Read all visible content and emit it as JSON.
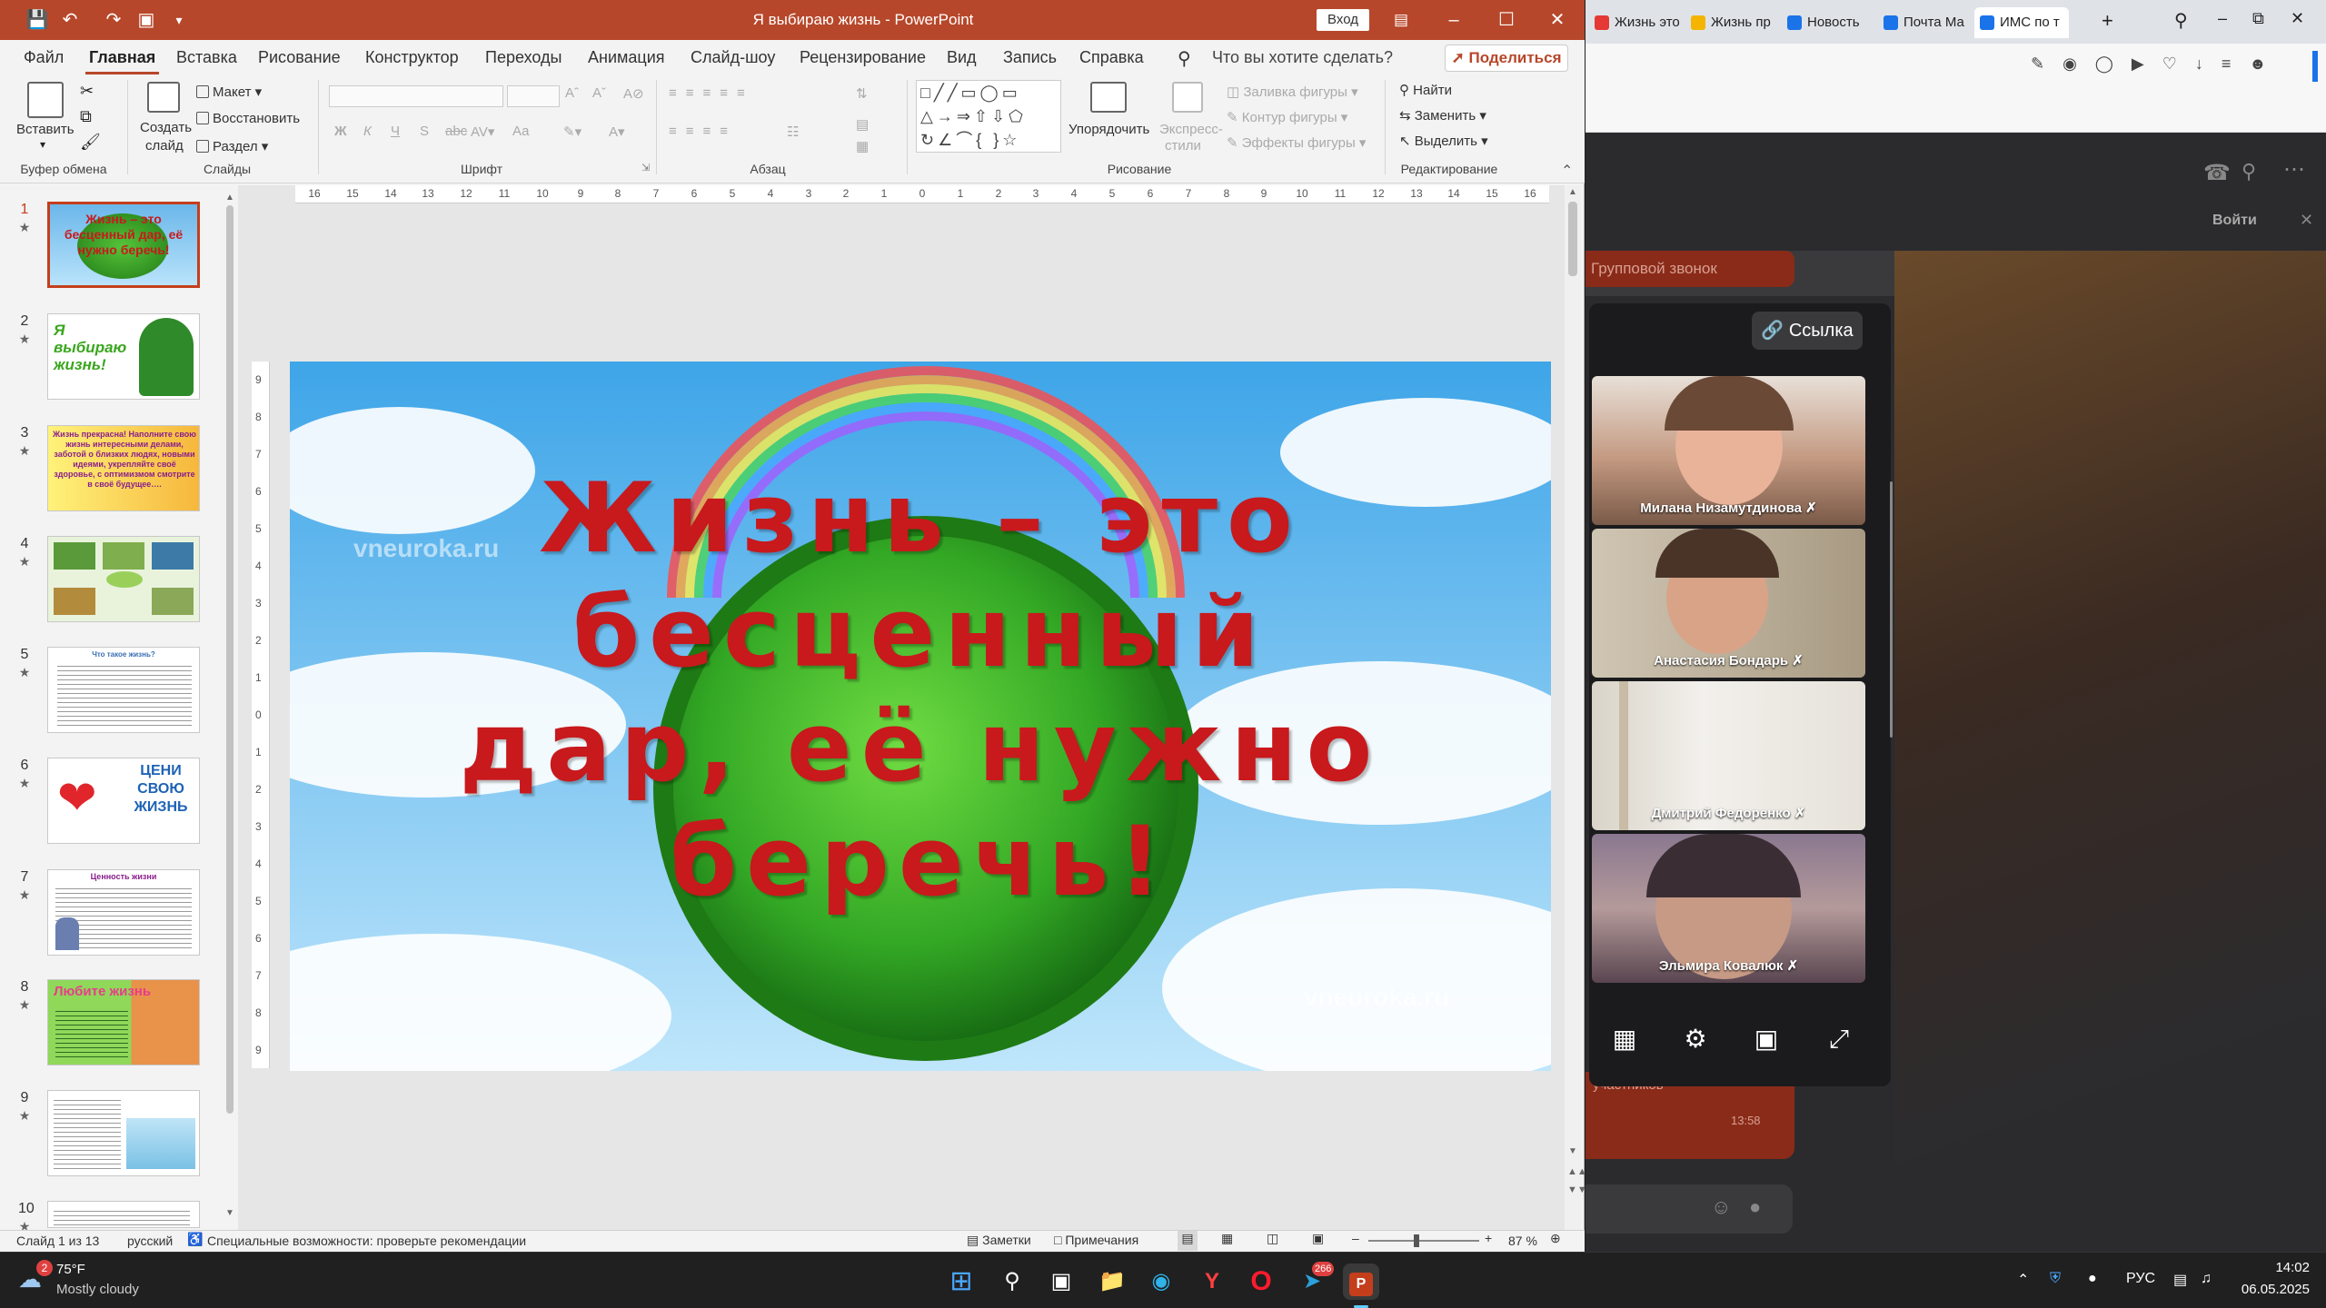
{
  "ppt": {
    "window_title": "Я выбираю жизнь - PowerPoint",
    "sign_in": "Вход",
    "menu": [
      "Файл",
      "Главная",
      "Вставка",
      "Рисование",
      "Конструктор",
      "Переходы",
      "Анимация",
      "Слайд-шоу",
      "Рецензирование",
      "Вид",
      "Запись",
      "Справка"
    ],
    "tell_me": "Что вы хотите сделать?",
    "share": "Поделиться",
    "ribbon": {
      "paste": "Вставить",
      "new_slide_1": "Создать",
      "new_slide_2": "слайд",
      "layout": "Макет",
      "reset": "Восстановить",
      "section": "Раздел",
      "arrange": "Упорядочить",
      "quick_styles_1": "Экспресс-",
      "quick_styles_2": "стили",
      "shape_fill": "Заливка фигуры",
      "shape_outline": "Контур фигуры",
      "shape_effects": "Эффекты фигуры",
      "find": "Найти",
      "replace": "Заменить",
      "select": "Выделить",
      "groups": {
        "clipboard": "Буфер обмена",
        "slides": "Слайды",
        "font": "Шрифт",
        "paragraph": "Абзац",
        "drawing": "Рисование",
        "editing": "Редактирование"
      },
      "font_btns": {
        "bold": "Ж",
        "italic": "К",
        "underline": "Ч",
        "strike": "S",
        "aa": "Аа"
      }
    },
    "ruler_h_labels": [
      "16",
      "15",
      "14",
      "13",
      "12",
      "11",
      "10",
      "9",
      "8",
      "7",
      "6",
      "5",
      "4",
      "3",
      "2",
      "1",
      "0",
      "1",
      "2",
      "3",
      "4",
      "5",
      "6",
      "7",
      "8",
      "9",
      "10",
      "11",
      "12",
      "13",
      "14",
      "15",
      "16"
    ],
    "ruler_v_labels": [
      "9",
      "8",
      "7",
      "6",
      "5",
      "4",
      "3",
      "2",
      "1",
      "0",
      "1",
      "2",
      "3",
      "4",
      "5",
      "6",
      "7",
      "8",
      "9"
    ],
    "slides": [
      {
        "num": "1",
        "text": "Жизнь – это бесценный дар, её нужно беречь!"
      },
      {
        "num": "2",
        "text": "Я выбираю жизнь!"
      },
      {
        "num": "3",
        "text": "Жизнь прекрасна! Наполните свою жизнь интересными делами, заботой о близких людях, новыми идеями, укрепляйте своё здоровье, с оптимизмом смотрите в своё будущее…."
      },
      {
        "num": "4",
        "text": ""
      },
      {
        "num": "5",
        "text": "Что такое жизнь?"
      },
      {
        "num": "6",
        "text": "ЦЕНИ СВОЮ ЖИЗНЬ"
      },
      {
        "num": "7",
        "text": "Ценность жизни"
      },
      {
        "num": "8",
        "text": "Любите жизнь"
      },
      {
        "num": "9",
        "text": ""
      },
      {
        "num": "10",
        "text": ""
      }
    ],
    "main_slide": {
      "lines": [
        "Жизнь – это",
        "бесценный",
        "дар, её нужно",
        "беречь!"
      ],
      "watermark": "vneuroka.ru"
    },
    "status": {
      "slide_of": "Слайд 1 из 13",
      "language": "русский",
      "accessibility": "Специальные возможности: проверьте рекомендации",
      "notes": "Заметки",
      "comments": "Примечания",
      "zoom": "87 %"
    }
  },
  "browser": {
    "tabs": [
      {
        "label": "Жизнь это",
        "color": "#e53935"
      },
      {
        "label": "Жизнь пр",
        "color": "#f4b400"
      },
      {
        "label": "Новость",
        "color": "#1a73e8"
      },
      {
        "label": "Почта Ма",
        "color": "#1a73e8"
      },
      {
        "label": "ИМС по т",
        "color": "#1a73e8"
      }
    ],
    "join_button": "Войти",
    "call_label": "Групповой звонок",
    "link_button": "Ссылка",
    "participants_hint": "участников",
    "msg_time": "13:58",
    "participants": [
      {
        "name": "Милана Низамутдинова"
      },
      {
        "name": "Анастасия Бондарь"
      },
      {
        "name": "Дмитрий Федоренко"
      },
      {
        "name": "Эльмира Ковалюк"
      }
    ]
  },
  "taskbar": {
    "weather_temp": "75°F",
    "weather_desc": "Mostly cloudy",
    "weather_badge": "2",
    "telegram_badge": "266",
    "lang": "РУС",
    "time": "14:02",
    "date": "06.05.2025"
  }
}
